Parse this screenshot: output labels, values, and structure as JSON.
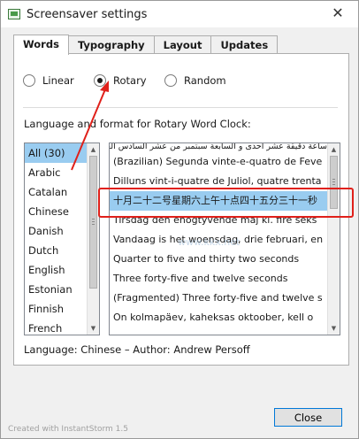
{
  "window": {
    "title": "Screensaver settings",
    "close_glyph": "✕"
  },
  "tabs": [
    {
      "label": "Words",
      "active": true
    },
    {
      "label": "Typography",
      "active": false
    },
    {
      "label": "Layout",
      "active": false
    },
    {
      "label": "Updates",
      "active": false
    }
  ],
  "mode": {
    "options": [
      {
        "label": "Linear",
        "checked": false
      },
      {
        "label": "Rotary",
        "checked": true
      },
      {
        "label": "Random",
        "checked": false
      }
    ]
  },
  "section_label": "Language and format for Rotary Word Clock:",
  "languages": {
    "items": [
      "All (30)",
      "Arabic",
      "Catalan",
      "Chinese",
      "Danish",
      "Dutch",
      "English",
      "Estonian",
      "Finnish",
      "French"
    ],
    "selected_index": 0
  },
  "formats": {
    "items": [
      "ساعة دقيقة عشر احدى و السابعة سبتمبر من عشر السادس الخميس",
      "(Brazilian) Segunda vinte-e-quatro de Feve",
      "Dilluns vint-i-quatre de Juliol, quatre trenta",
      "十月二十二号星期六上午十点四十五分三十一秒",
      "Tirsdag den enogtyvende maj kl. fire seks",
      "Vandaag is het woensdag, drie februari, en",
      "Quarter to five and thirty two seconds",
      "Three forty-five and twelve seconds",
      "(Fragmented) Three forty-five and twelve s",
      "On kolmapäev, kaheksas oktoober, kell o"
    ],
    "selected_index": 3
  },
  "info": {
    "text": "Language: Chinese – Author: Andrew Persoff"
  },
  "buttons": {
    "close": "Close"
  },
  "credit": "Created with InstantStorm 1.5",
  "watermark": "www.kkx.net",
  "annotation": {
    "color": "#e0201a"
  }
}
